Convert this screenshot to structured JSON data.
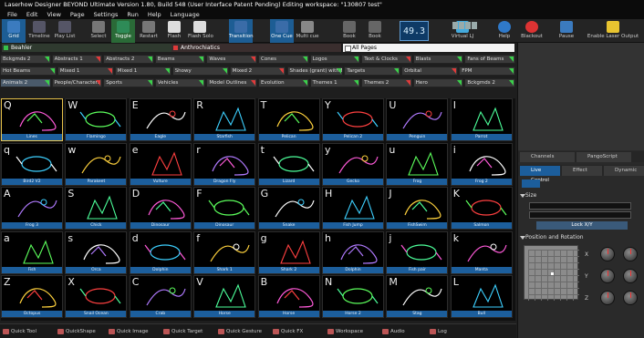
{
  "window": {
    "title": "Laserhow Designer BEYOND Ultimate   Version 1.80, Build 548   (User Interface Patent Pending)   Editing workspace: \"130807 test\""
  },
  "menu": [
    "File",
    "Edit",
    "View",
    "Page",
    "Settings",
    "Run",
    "Help",
    "Language"
  ],
  "toolbar": {
    "left": [
      "Grid",
      "Timeline",
      "Play List",
      "Select",
      "Toggle",
      "Restart",
      "Flash",
      "Flash Solo",
      "Transition",
      "One Cue",
      "Multi cue",
      "Book",
      "Book"
    ],
    "bpm_display": "49.3",
    "right": [
      "Virtual LJ",
      "Help",
      "Blackout",
      "Pause",
      "Enable Laser Output"
    ]
  },
  "workspaces": [
    "Beahler",
    "Anthrochiatics",
    "All Pages"
  ],
  "categories": [
    [
      "Bckgmds 2",
      "Abstracts 1",
      "Abstracts 2",
      "Beams",
      "Waves",
      "Cones",
      "Logos",
      "Text & Clocks",
      "Blasts",
      "Fans of Beams"
    ],
    [
      "Hot Beams",
      "Mixed 1",
      "Mixed 1",
      "Showy",
      "Mixed 2",
      "Shades (grant) with Mirrod LD",
      "Targets",
      "Orbital",
      "FPM"
    ],
    [
      "Animals 2",
      "People/Characters",
      "Sports",
      "Vehicles",
      "Model Outlines",
      "Evolution",
      "Themes 1",
      "Themes 2",
      "Hero",
      "Bckgmds 2"
    ]
  ],
  "grid_rows": [
    [
      {
        "k": "Q",
        "c": "Lines"
      },
      {
        "k": "W",
        "c": "Flamingo"
      },
      {
        "k": "E",
        "c": "Eagle"
      },
      {
        "k": "R",
        "c": "Starfish"
      },
      {
        "k": "T",
        "c": "Pelican"
      },
      {
        "k": "Y",
        "c": "Pelican 2"
      },
      {
        "k": "U",
        "c": "Penguin"
      },
      {
        "k": "I",
        "c": "Parrot"
      }
    ],
    [
      {
        "k": "q",
        "c": "Bird2 V2"
      },
      {
        "k": "w",
        "c": "Parakeet"
      },
      {
        "k": "e",
        "c": "Vulture"
      },
      {
        "k": "r",
        "c": "Dragon Fly"
      },
      {
        "k": "t",
        "c": "Lizard"
      },
      {
        "k": "y",
        "c": "Gecko"
      },
      {
        "k": "u",
        "c": "Frog"
      },
      {
        "k": "i",
        "c": "Frog 2"
      }
    ],
    [
      {
        "k": "A",
        "c": "Frog 3"
      },
      {
        "k": "S",
        "c": "Chick"
      },
      {
        "k": "D",
        "c": "Dinosaur"
      },
      {
        "k": "F",
        "c": "Dinosaur"
      },
      {
        "k": "G",
        "c": "Snake"
      },
      {
        "k": "H",
        "c": "Fish Jump"
      },
      {
        "k": "J",
        "c": "FishSwim"
      },
      {
        "k": "K",
        "c": "Salmon"
      }
    ],
    [
      {
        "k": "a",
        "c": "Fish"
      },
      {
        "k": "s",
        "c": "Orca"
      },
      {
        "k": "d",
        "c": "Dolphin"
      },
      {
        "k": "f",
        "c": "Shark 1"
      },
      {
        "k": "g",
        "c": "Shark 2"
      },
      {
        "k": "h",
        "c": "Dolphin"
      },
      {
        "k": "j",
        "c": "Fish pair"
      },
      {
        "k": "k",
        "c": "Manta"
      }
    ],
    [
      {
        "k": "Z",
        "c": "Octopus"
      },
      {
        "k": "X",
        "c": "Snail Ocean"
      },
      {
        "k": "C",
        "c": "Crab"
      },
      {
        "k": "V",
        "c": "Horse"
      },
      {
        "k": "B",
        "c": "Horse"
      },
      {
        "k": "N",
        "c": "Horse 2"
      },
      {
        "k": "M",
        "c": "Stag"
      },
      {
        "k": "L",
        "c": "Bull"
      }
    ]
  ],
  "bottom_tabs": [
    "Quick Tool",
    "QuickShape",
    "Quick Image",
    "Quick Target",
    "Quick Gesture",
    "Quick FX",
    "Workspace",
    "Audio",
    "Log"
  ],
  "right_panel": {
    "tabs": [
      "Channels",
      "PangoScript"
    ],
    "tabs2": [
      "Live Control",
      "Effect",
      "Dynamic"
    ],
    "size_label": "Size",
    "lock_label": "Lock X/Y",
    "position_label": "Position and Rotation",
    "axes": [
      "X",
      "Y",
      "Z"
    ]
  },
  "colors": {
    "accent": "#1c5e9c",
    "selected": "#e8c24a"
  }
}
